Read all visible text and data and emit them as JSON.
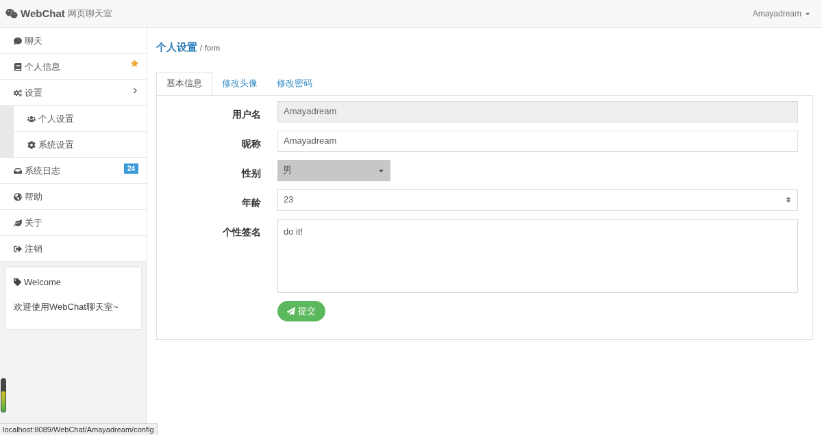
{
  "navbar": {
    "brand": "WebChat",
    "subtitle": "网页聊天室",
    "user": "Amayadream"
  },
  "sidebar": {
    "items": [
      {
        "label": "聊天",
        "starred": false
      },
      {
        "label": "个人信息",
        "starred": true
      },
      {
        "label": "设置",
        "starred": false,
        "expanded": true,
        "children": [
          {
            "label": "个人设置"
          },
          {
            "label": "系统设置"
          }
        ]
      },
      {
        "label": "系统日志",
        "starred": false,
        "badge": "24"
      },
      {
        "label": "帮助",
        "starred": false
      },
      {
        "label": "关于",
        "starred": false
      },
      {
        "label": "注销",
        "starred": false
      }
    ],
    "welcome": {
      "title": "Welcome",
      "text": "欢迎使用WebChat聊天室~"
    }
  },
  "breadcrumb": {
    "current": "个人设置",
    "separator": "/",
    "sub": "form"
  },
  "tabs": [
    {
      "label": "基本信息",
      "selected": true
    },
    {
      "label": "修改头像",
      "selected": false
    },
    {
      "label": "修改密码",
      "selected": false
    }
  ],
  "form": {
    "fields": [
      {
        "kind": "text",
        "label": "用户名",
        "value": "Amayadream",
        "disabled": true
      },
      {
        "kind": "text",
        "label": "昵称",
        "value": "Amayadream",
        "disabled": false
      },
      {
        "kind": "select",
        "label": "性别",
        "value": "男"
      },
      {
        "kind": "number",
        "label": "年龄",
        "value": "23"
      },
      {
        "kind": "textarea",
        "label": "个性签名",
        "value": "do it!"
      }
    ],
    "submit": "提交"
  },
  "status_bar": "localhost:8089/WebChat/Amayadream/config"
}
